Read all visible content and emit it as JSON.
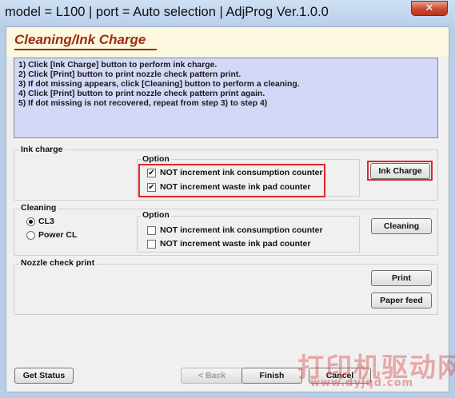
{
  "window": {
    "title": "model = L100 | port = Auto selection | AdjProg Ver.1.0.0",
    "close_label": "✕"
  },
  "page": {
    "title": "Cleaning/Ink Charge"
  },
  "instructions": [
    "1) Click [Ink Charge] button to perform ink charge.",
    "2) Click [Print] button to print nozzle check pattern print.",
    "3) If dot missing appears, click [Cleaning] button to perform a cleaning.",
    "4) Click [Print] button to print nozzle check pattern print again.",
    "5) If dot missing is not recovered, repeat from step 3) to step 4)"
  ],
  "ink_charge": {
    "group_label": "Ink charge",
    "option_label": "Option",
    "options": [
      {
        "label": "NOT increment ink consumption counter",
        "checked": true
      },
      {
        "label": "NOT increment waste ink pad counter",
        "checked": true
      }
    ],
    "button_label": "Ink Charge"
  },
  "cleaning": {
    "group_label": "Cleaning",
    "radios": [
      {
        "label": "CL3",
        "selected": true
      },
      {
        "label": "Power CL",
        "selected": false
      }
    ],
    "option_label": "Option",
    "options": [
      {
        "label": "NOT increment ink consumption counter",
        "checked": false
      },
      {
        "label": "NOT increment waste ink pad counter",
        "checked": false
      }
    ],
    "button_label": "Cleaning"
  },
  "nozzle_check": {
    "group_label": "Nozzle check print",
    "print_label": "Print",
    "paper_feed_label": "Paper feed"
  },
  "footer": {
    "get_status_label": "Get Status",
    "back_label": "< Back",
    "finish_label": "Finish",
    "cancel_label": "Cancel"
  },
  "watermark": {
    "text": "打印机驱动网",
    "url": "www.dyjqd.com"
  },
  "colors": {
    "title_accent": "#9c2e10",
    "instructions_bg": "#d3d8f7",
    "highlight": "#e0262b"
  }
}
